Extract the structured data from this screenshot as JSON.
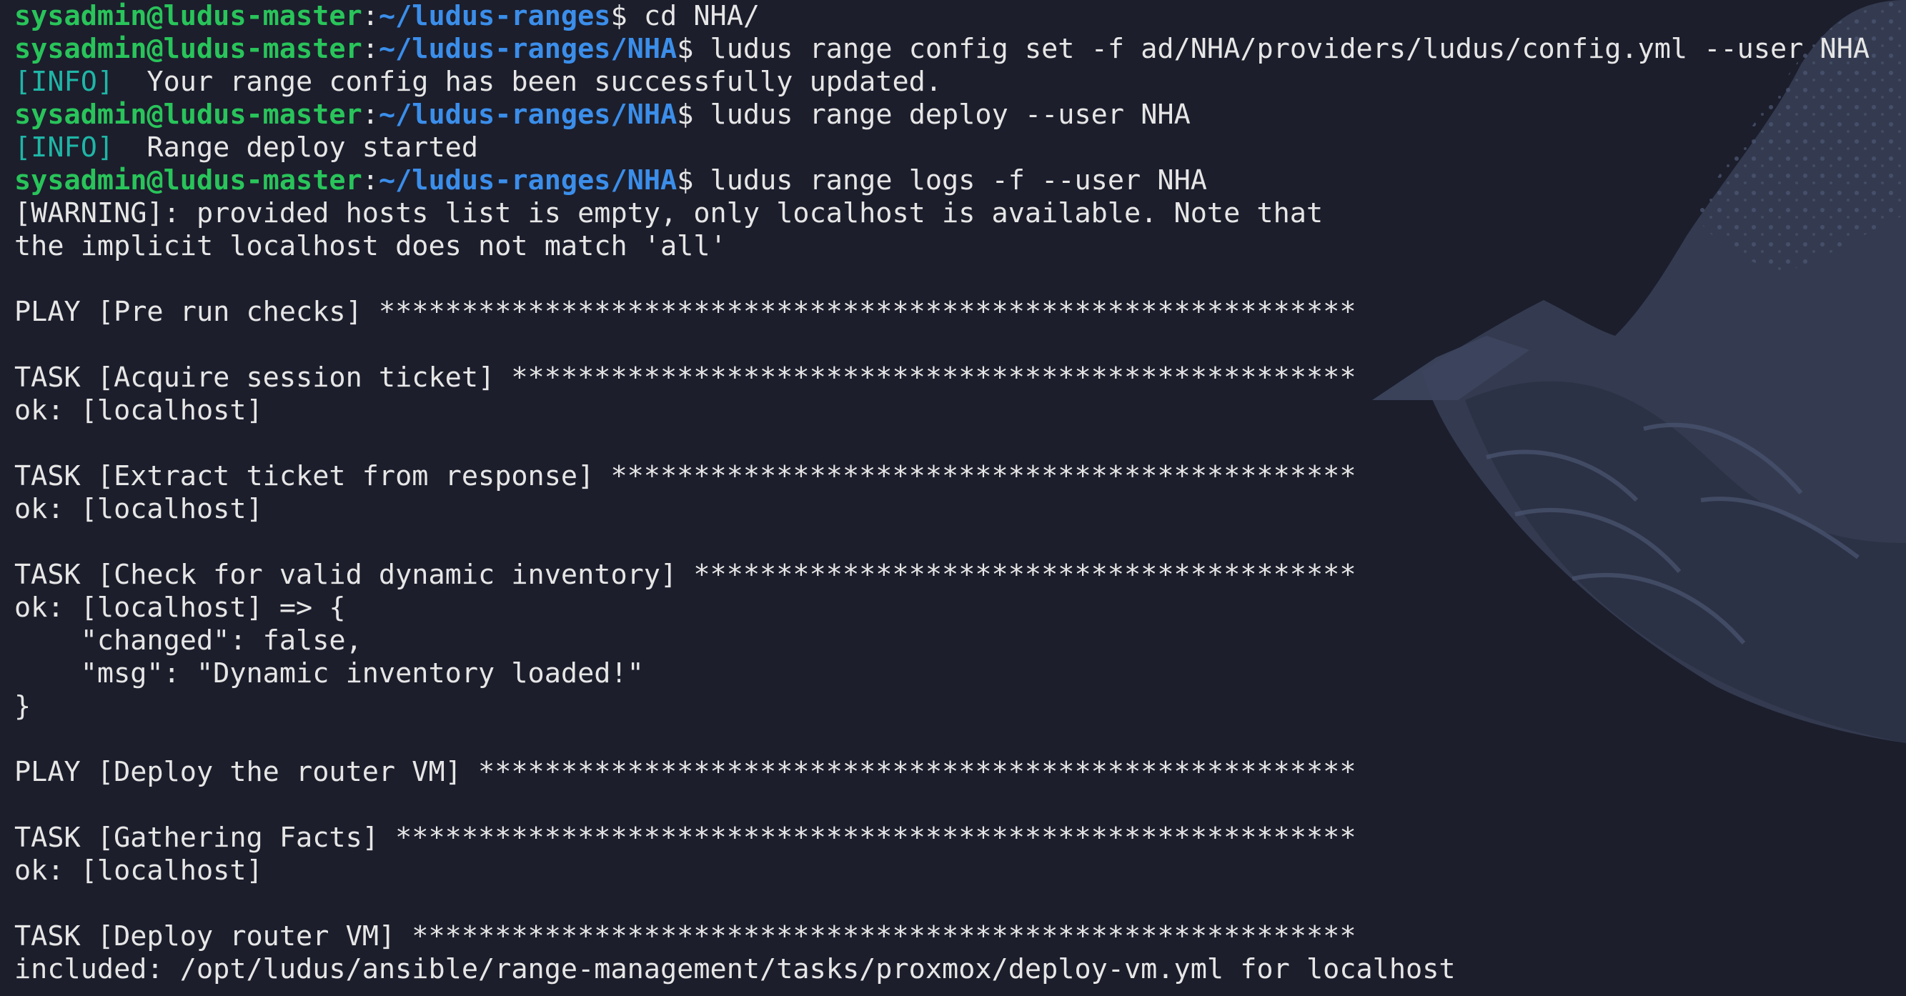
{
  "prompt": {
    "user_host": "sysadmin@ludus-master",
    "colon": ":",
    "dollar": "$"
  },
  "lines": [
    {
      "type": "prompt",
      "path": "~/ludus-ranges",
      "command": " cd NHA/"
    },
    {
      "type": "prompt",
      "path": "~/ludus-ranges/NHA",
      "command": " ludus range config set -f ad/NHA/providers/ludus/config.yml --user NHA"
    },
    {
      "type": "info",
      "tag": "[INFO]",
      "text": "  Your range config has been successfully updated."
    },
    {
      "type": "prompt",
      "path": "~/ludus-ranges/NHA",
      "command": " ludus range deploy --user NHA"
    },
    {
      "type": "info",
      "tag": "[INFO]",
      "text": "  Range deploy started"
    },
    {
      "type": "prompt",
      "path": "~/ludus-ranges/NHA",
      "command": " ludus range logs -f --user NHA"
    },
    {
      "type": "text",
      "text": "[WARNING]: provided hosts list is empty, only localhost is available. Note that"
    },
    {
      "type": "text",
      "text": "the implicit localhost does not match 'all'"
    },
    {
      "type": "text",
      "text": ""
    },
    {
      "type": "text",
      "text": "PLAY [Pre run checks] ***********************************************************"
    },
    {
      "type": "text",
      "text": ""
    },
    {
      "type": "text",
      "text": "TASK [Acquire session ticket] ***************************************************"
    },
    {
      "type": "text",
      "text": "ok: [localhost]"
    },
    {
      "type": "text",
      "text": ""
    },
    {
      "type": "text",
      "text": "TASK [Extract ticket from response] *********************************************"
    },
    {
      "type": "text",
      "text": "ok: [localhost]"
    },
    {
      "type": "text",
      "text": ""
    },
    {
      "type": "text",
      "text": "TASK [Check for valid dynamic inventory] ****************************************"
    },
    {
      "type": "text",
      "text": "ok: [localhost] => {"
    },
    {
      "type": "text",
      "text": "    \"changed\": false,"
    },
    {
      "type": "text",
      "text": "    \"msg\": \"Dynamic inventory loaded!\""
    },
    {
      "type": "text",
      "text": "}"
    },
    {
      "type": "text",
      "text": ""
    },
    {
      "type": "text",
      "text": "PLAY [Deploy the router VM] *****************************************************"
    },
    {
      "type": "text",
      "text": ""
    },
    {
      "type": "text",
      "text": "TASK [Gathering Facts] **********************************************************"
    },
    {
      "type": "text",
      "text": "ok: [localhost]"
    },
    {
      "type": "text",
      "text": ""
    },
    {
      "type": "text",
      "text": "TASK [Deploy router VM] *********************************************************"
    },
    {
      "type": "text",
      "text": "included: /opt/ludus/ansible/range-management/tasks/proxmox/deploy-vm.yml for localhost"
    }
  ],
  "colors": {
    "background": "#1c1e2c",
    "user": "#29c45a",
    "path": "#3b8eea",
    "info": "#1fb6a6",
    "text": "#e6e6e6",
    "wallpaper_wave": "#3a4258"
  },
  "wallpaper_icon": "great-wave-wallpaper"
}
